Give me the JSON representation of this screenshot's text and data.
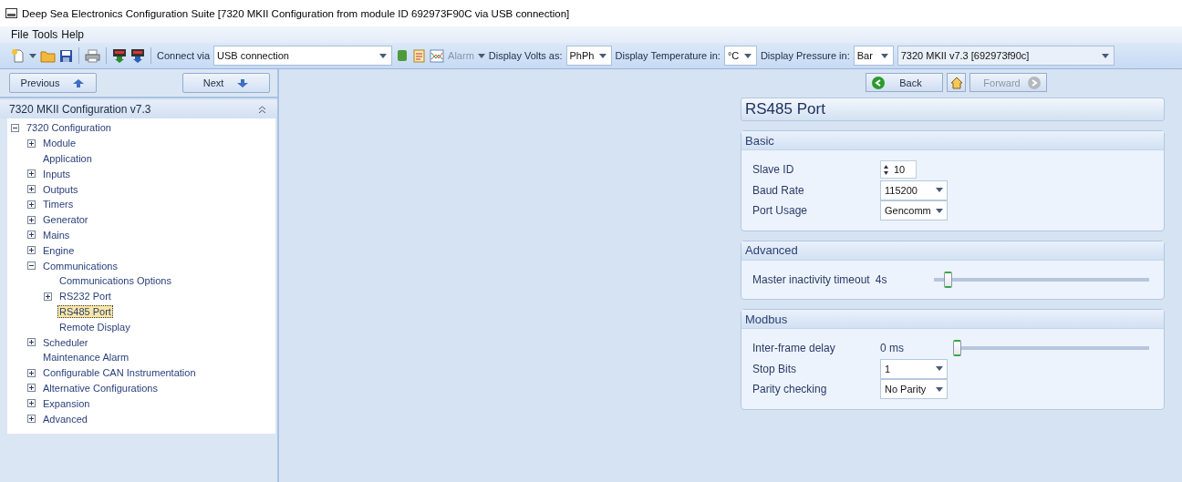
{
  "window": {
    "title": "Deep Sea Electronics Configuration Suite [7320 MKII Configuration from module ID 692973F90C via USB connection]"
  },
  "menu": [
    "File",
    "Tools",
    "Help"
  ],
  "toolbar": {
    "connect_label": "Connect via",
    "connection": "USB connection",
    "alarm": {
      "label": "Alarm",
      "disabled": true
    },
    "volts_label": "Display Volts as:",
    "volts": "PhPh",
    "temperature_label": "Display Temperature in:",
    "temperature": "°C",
    "pressure_label": "Display Pressure in:",
    "pressure": "Bar",
    "module": "7320 MKII v7.3 [692973f90c]"
  },
  "nav": {
    "previous": "Previous",
    "next": "Next"
  },
  "sidebar": {
    "header": "7320 MKII Configuration v7.3",
    "tree": [
      {
        "label": "7320 Configuration",
        "kind": "folder",
        "expanded": true,
        "selected": false,
        "children": [
          {
            "label": "Module",
            "kind": "folder",
            "expanded": false,
            "selected": false
          },
          {
            "label": "Application",
            "kind": "leaf",
            "selected": false
          },
          {
            "label": "Inputs",
            "kind": "folder",
            "expanded": false,
            "selected": false
          },
          {
            "label": "Outputs",
            "kind": "folder",
            "expanded": false,
            "selected": false
          },
          {
            "label": "Timers",
            "kind": "folder",
            "expanded": false,
            "selected": false
          },
          {
            "label": "Generator",
            "kind": "folder",
            "expanded": false,
            "selected": false
          },
          {
            "label": "Mains",
            "kind": "folder",
            "expanded": false,
            "selected": false
          },
          {
            "label": "Engine",
            "kind": "folder",
            "expanded": false,
            "selected": false
          },
          {
            "label": "Communications",
            "kind": "folder",
            "expanded": true,
            "selected": false,
            "children": [
              {
                "label": "Communications Options",
                "kind": "leaf",
                "selected": false
              },
              {
                "label": "RS232 Port",
                "kind": "folder",
                "expanded": false,
                "selected": false
              },
              {
                "label": "RS485 Port",
                "kind": "leaf",
                "selected": true
              },
              {
                "label": "Remote Display",
                "kind": "leaf",
                "selected": false
              }
            ]
          },
          {
            "label": "Scheduler",
            "kind": "folder",
            "expanded": false,
            "selected": false
          },
          {
            "label": "Maintenance Alarm",
            "kind": "leaf",
            "selected": false
          },
          {
            "label": "Configurable CAN Instrumentation",
            "kind": "folder",
            "expanded": false,
            "selected": false
          },
          {
            "label": "Alternative Configurations",
            "kind": "folder",
            "expanded": false,
            "selected": false
          },
          {
            "label": "Expansion",
            "kind": "folder",
            "expanded": false,
            "selected": false
          },
          {
            "label": "Advanced",
            "kind": "folder",
            "expanded": false,
            "selected": false
          }
        ]
      }
    ]
  },
  "page_nav": {
    "back": "Back",
    "forward": {
      "label": "Forward",
      "disabled": true
    }
  },
  "page": {
    "title": "RS485 Port",
    "sections": [
      {
        "title": "Basic",
        "rows": [
          {
            "kind": "spinner",
            "label": "Slave ID",
            "value": "10"
          },
          {
            "kind": "dropdown",
            "label": "Baud Rate",
            "value": "115200"
          },
          {
            "kind": "dropdown",
            "label": "Port Usage",
            "value": "Gencomm"
          }
        ]
      },
      {
        "title": "Advanced",
        "rows": [
          {
            "kind": "slider",
            "label": "Master inactivity timeout",
            "reading": "4s",
            "level": 0.05
          }
        ]
      },
      {
        "title": "Modbus",
        "rows": [
          {
            "kind": "slider",
            "label": "Inter-frame delay",
            "reading": "0 ms",
            "level": 0
          },
          {
            "kind": "dropdown",
            "label": "Stop Bits",
            "value": "1"
          },
          {
            "kind": "dropdown",
            "label": "Parity checking",
            "value": "No Parity"
          }
        ]
      }
    ]
  }
}
